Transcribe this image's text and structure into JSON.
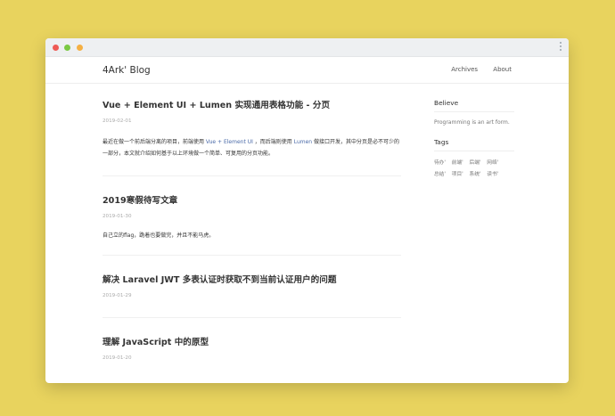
{
  "window": {
    "dots": [
      "red",
      "yellow",
      "green"
    ]
  },
  "nav": {
    "brand": "4Ark' Blog",
    "links": [
      "Archives",
      "About"
    ]
  },
  "posts": [
    {
      "title": "Vue + Element UI + Lumen 实现通用表格功能 - 分页",
      "date": "2019-02-01",
      "excerpt_parts": [
        "最近在做一个前后端分离的项目，前端使用 ",
        "Vue + Element UI",
        " ，而后端则使用 ",
        "Lumen",
        " 做接口开发，其中分页是必不可少的一部分，本文就介绍如何基于以上环境做一个简单、可复用的分页功能。"
      ]
    },
    {
      "title": "2019寒假待写文章",
      "date": "2019-01-30",
      "excerpt": "自己立的flag，跪着也要做完，并且不能马虎。"
    },
    {
      "title": "解决 Laravel JWT 多表认证时获取不到当前认证用户的问题",
      "date": "2019-01-29"
    },
    {
      "title": "理解 JavaScript 中的原型",
      "date": "2019-01-20"
    }
  ],
  "sidebar": {
    "believe_title": "Believe",
    "believe_text": "Programming is an art form.",
    "tags_title": "Tags",
    "tags_row1": [
      "待办'",
      "前端'",
      "后端'",
      "网络'"
    ],
    "tags_row2": [
      "总结'",
      "项目'",
      "系统'",
      "读书'"
    ]
  },
  "colors": {
    "background": "#e8d35e",
    "link": "#4a6aa8"
  }
}
